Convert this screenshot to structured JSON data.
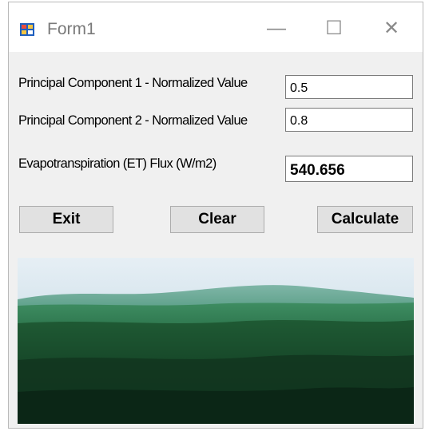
{
  "window": {
    "title": "Form1",
    "controls": {
      "minimize": "—",
      "maximize": "☐",
      "close": "✕"
    }
  },
  "fields": [
    {
      "label": "Principal Component 1 - Normalized Value",
      "value": "0.5"
    },
    {
      "label": "Principal Component 2 - Normalized Value",
      "value": "0.8"
    },
    {
      "label": "Evapotranspiration (ET) Flux (W/m2)",
      "value": "540.656"
    }
  ],
  "buttons": {
    "exit": "Exit",
    "clear": "Clear",
    "calculate": "Calculate"
  },
  "image": {
    "subject": "forest-landscape-photo"
  }
}
